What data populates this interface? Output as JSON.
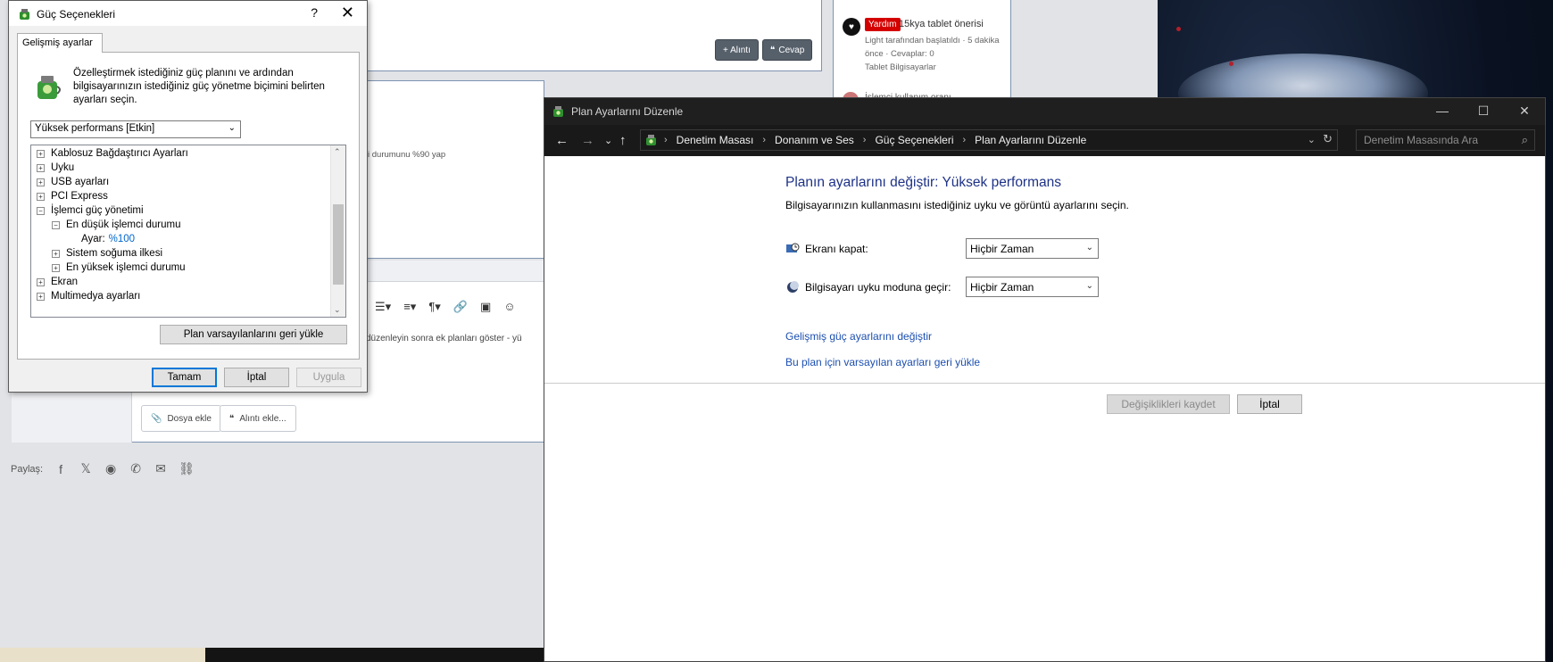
{
  "dialog": {
    "title": "Güç Seçenekleri",
    "help_glyph": "?",
    "close_glyph": "✕",
    "tab_label": "Gelişmiş ayarlar",
    "description": "Özelleştirmek istediğiniz güç planını ve ardından bilgisayarınızın istediğiniz güç yönetme biçimini belirten ayarları seçin.",
    "plan_select": "Yüksek performans [Etkin]",
    "tree": {
      "items": [
        {
          "label": "Kablosuz Bağdaştırıcı Ayarları",
          "expander": "+"
        },
        {
          "label": "Uyku",
          "expander": "+"
        },
        {
          "label": "USB ayarları",
          "expander": "+"
        },
        {
          "label": "PCI Express",
          "expander": "+"
        },
        {
          "label": "İşlemci güç yönetimi",
          "expander": "−"
        },
        {
          "label": "En düşük işlemci durumu",
          "expander": "−"
        },
        {
          "label": "Ayar:",
          "value": "%100"
        },
        {
          "label": "Sistem soğuma ilkesi",
          "expander": "+"
        },
        {
          "label": "En yüksek işlemci durumu",
          "expander": "+"
        },
        {
          "label": "Ekran",
          "expander": "+"
        },
        {
          "label": "Multimedya ayarları",
          "expander": "+"
        }
      ]
    },
    "restore_button": "Plan varsayılanlarını geri yükle",
    "ok_button": "Tamam",
    "cancel_button": "İptal",
    "apply_button": "Uygula"
  },
  "control_panel": {
    "window_title": "Plan Ayarlarını Düzenle",
    "window_buttons": {
      "minimize": "—",
      "maximize": "☐",
      "close": "✕"
    },
    "breadcrumbs": [
      "Denetim Masası",
      "Donanım ve Ses",
      "Güç Seçenekleri",
      "Plan Ayarlarını Düzenle"
    ],
    "search_placeholder": "Denetim Masasında Ara",
    "heading": "Planın ayarlarını değiştir: Yüksek performans",
    "subheading": "Bilgisayarınızın kullanmasını istediğiniz uyku ve görüntü ayarlarını seçin.",
    "display_off_label": "Ekranı kapat:",
    "display_off_value": "Hiçbir Zaman",
    "sleep_label": "Bilgisayarı uyku moduna geçir:",
    "sleep_value": "Hiçbir Zaman",
    "advanced_link": "Gelişmiş güç ayarlarını değiştir",
    "restore_link": "Bu plan için varsayılan ayarları geri yükle",
    "save_button": "Değişiklikleri kaydet",
    "cancel_button": "İptal"
  },
  "background": {
    "quote_button": "+ Alıntı",
    "reply_button": "Cevap",
    "post_snippet": "i durumunu %90 yap",
    "reply_text": "düzenleyin  sonra  ek planları göster - yü",
    "attach_file": "Dosya ekle",
    "attach_quote": "Alıntı ekle...",
    "share_label": "Paylaş:",
    "sidebar": {
      "tag": "Yardım",
      "title": "15kya tablet önerisi",
      "meta_line1": "Light tarafından başlatıldı · 5 dakika",
      "meta_line2": "önce · Cevaplar: 0",
      "forum": "Tablet Bilgisayarlar",
      "next_thread": "İşlemci kullanım oranı..."
    }
  },
  "colors": {
    "link": "#1c4fb0",
    "heading": "#1e3287",
    "tree_value": "#0066cc",
    "primary_border": "#0078d7",
    "tag_red": "#d40000"
  }
}
